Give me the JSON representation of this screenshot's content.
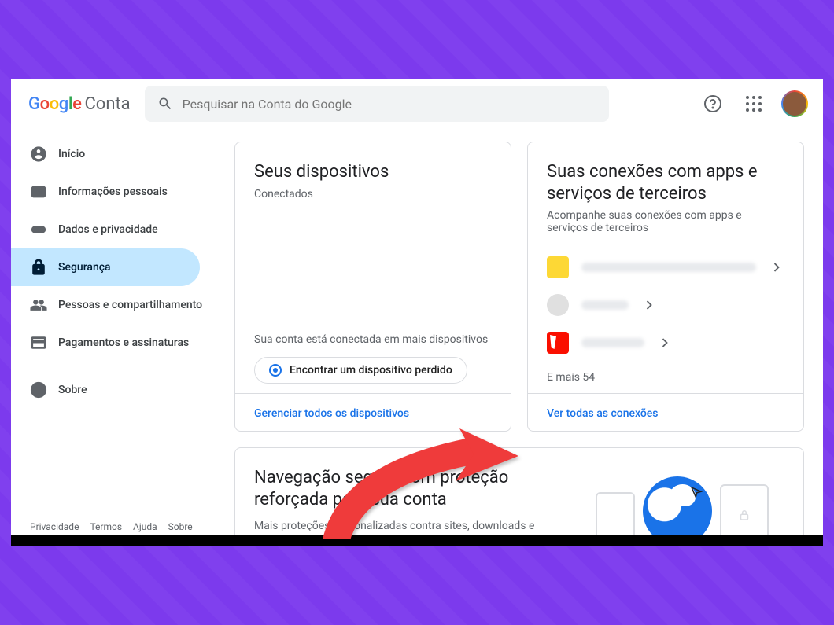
{
  "header": {
    "logo_account": "Conta",
    "search_placeholder": "Pesquisar na Conta do Google"
  },
  "sidebar": {
    "items": [
      {
        "label": "Início"
      },
      {
        "label": "Informações pessoais"
      },
      {
        "label": "Dados e privacidade"
      },
      {
        "label": "Segurança"
      },
      {
        "label": "Pessoas e compartilhamento"
      },
      {
        "label": "Pagamentos e assinaturas"
      },
      {
        "label": "Sobre"
      }
    ],
    "footer": [
      "Privacidade",
      "Termos",
      "Ajuda",
      "Sobre"
    ]
  },
  "devices": {
    "title": "Seus dispositivos",
    "subtitle": "Conectados",
    "connected_text": "Sua conta está conectada em mais dispositivos",
    "find_button": "Encontrar um dispositivo perdido",
    "manage_link": "Gerenciar todos os dispositivos"
  },
  "connections": {
    "title": "Suas conexões com apps e serviços de terceiros",
    "subtitle": "Acompanhe suas conexões com apps e serviços de terceiros",
    "more": "E mais 54",
    "see_all": "Ver todas as conexões"
  },
  "safebrowsing": {
    "title": "Navegação segura com proteção reforçada para sua conta",
    "desc": "Mais proteções personalizadas contra sites, downloads e extensões perigosos."
  }
}
